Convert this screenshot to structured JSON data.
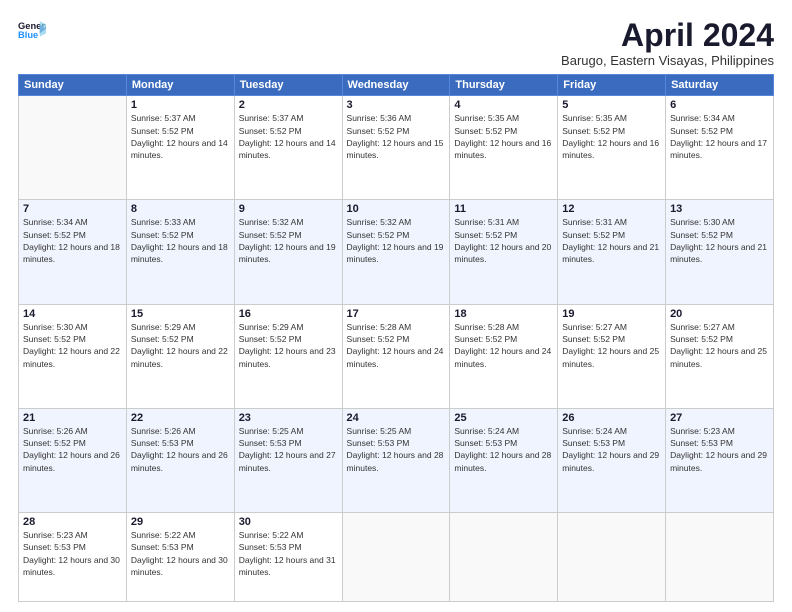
{
  "logo": {
    "line1": "General",
    "line2": "Blue",
    "icon": "▶"
  },
  "title": "April 2024",
  "location": "Barugo, Eastern Visayas, Philippines",
  "days_of_week": [
    "Sunday",
    "Monday",
    "Tuesday",
    "Wednesday",
    "Thursday",
    "Friday",
    "Saturday"
  ],
  "weeks": [
    [
      {
        "day": "",
        "sunrise": "",
        "sunset": "",
        "daylight": ""
      },
      {
        "day": "1",
        "sunrise": "5:37 AM",
        "sunset": "5:52 PM",
        "daylight": "12 hours and 14 minutes."
      },
      {
        "day": "2",
        "sunrise": "5:37 AM",
        "sunset": "5:52 PM",
        "daylight": "12 hours and 14 minutes."
      },
      {
        "day": "3",
        "sunrise": "5:36 AM",
        "sunset": "5:52 PM",
        "daylight": "12 hours and 15 minutes."
      },
      {
        "day": "4",
        "sunrise": "5:35 AM",
        "sunset": "5:52 PM",
        "daylight": "12 hours and 16 minutes."
      },
      {
        "day": "5",
        "sunrise": "5:35 AM",
        "sunset": "5:52 PM",
        "daylight": "12 hours and 16 minutes."
      },
      {
        "day": "6",
        "sunrise": "5:34 AM",
        "sunset": "5:52 PM",
        "daylight": "12 hours and 17 minutes."
      }
    ],
    [
      {
        "day": "7",
        "sunrise": "5:34 AM",
        "sunset": "5:52 PM",
        "daylight": "12 hours and 18 minutes."
      },
      {
        "day": "8",
        "sunrise": "5:33 AM",
        "sunset": "5:52 PM",
        "daylight": "12 hours and 18 minutes."
      },
      {
        "day": "9",
        "sunrise": "5:32 AM",
        "sunset": "5:52 PM",
        "daylight": "12 hours and 19 minutes."
      },
      {
        "day": "10",
        "sunrise": "5:32 AM",
        "sunset": "5:52 PM",
        "daylight": "12 hours and 19 minutes."
      },
      {
        "day": "11",
        "sunrise": "5:31 AM",
        "sunset": "5:52 PM",
        "daylight": "12 hours and 20 minutes."
      },
      {
        "day": "12",
        "sunrise": "5:31 AM",
        "sunset": "5:52 PM",
        "daylight": "12 hours and 21 minutes."
      },
      {
        "day": "13",
        "sunrise": "5:30 AM",
        "sunset": "5:52 PM",
        "daylight": "12 hours and 21 minutes."
      }
    ],
    [
      {
        "day": "14",
        "sunrise": "5:30 AM",
        "sunset": "5:52 PM",
        "daylight": "12 hours and 22 minutes."
      },
      {
        "day": "15",
        "sunrise": "5:29 AM",
        "sunset": "5:52 PM",
        "daylight": "12 hours and 22 minutes."
      },
      {
        "day": "16",
        "sunrise": "5:29 AM",
        "sunset": "5:52 PM",
        "daylight": "12 hours and 23 minutes."
      },
      {
        "day": "17",
        "sunrise": "5:28 AM",
        "sunset": "5:52 PM",
        "daylight": "12 hours and 24 minutes."
      },
      {
        "day": "18",
        "sunrise": "5:28 AM",
        "sunset": "5:52 PM",
        "daylight": "12 hours and 24 minutes."
      },
      {
        "day": "19",
        "sunrise": "5:27 AM",
        "sunset": "5:52 PM",
        "daylight": "12 hours and 25 minutes."
      },
      {
        "day": "20",
        "sunrise": "5:27 AM",
        "sunset": "5:52 PM",
        "daylight": "12 hours and 25 minutes."
      }
    ],
    [
      {
        "day": "21",
        "sunrise": "5:26 AM",
        "sunset": "5:52 PM",
        "daylight": "12 hours and 26 minutes."
      },
      {
        "day": "22",
        "sunrise": "5:26 AM",
        "sunset": "5:53 PM",
        "daylight": "12 hours and 26 minutes."
      },
      {
        "day": "23",
        "sunrise": "5:25 AM",
        "sunset": "5:53 PM",
        "daylight": "12 hours and 27 minutes."
      },
      {
        "day": "24",
        "sunrise": "5:25 AM",
        "sunset": "5:53 PM",
        "daylight": "12 hours and 28 minutes."
      },
      {
        "day": "25",
        "sunrise": "5:24 AM",
        "sunset": "5:53 PM",
        "daylight": "12 hours and 28 minutes."
      },
      {
        "day": "26",
        "sunrise": "5:24 AM",
        "sunset": "5:53 PM",
        "daylight": "12 hours and 29 minutes."
      },
      {
        "day": "27",
        "sunrise": "5:23 AM",
        "sunset": "5:53 PM",
        "daylight": "12 hours and 29 minutes."
      }
    ],
    [
      {
        "day": "28",
        "sunrise": "5:23 AM",
        "sunset": "5:53 PM",
        "daylight": "12 hours and 30 minutes."
      },
      {
        "day": "29",
        "sunrise": "5:22 AM",
        "sunset": "5:53 PM",
        "daylight": "12 hours and 30 minutes."
      },
      {
        "day": "30",
        "sunrise": "5:22 AM",
        "sunset": "5:53 PM",
        "daylight": "12 hours and 31 minutes."
      },
      {
        "day": "",
        "sunrise": "",
        "sunset": "",
        "daylight": ""
      },
      {
        "day": "",
        "sunrise": "",
        "sunset": "",
        "daylight": ""
      },
      {
        "day": "",
        "sunrise": "",
        "sunset": "",
        "daylight": ""
      },
      {
        "day": "",
        "sunrise": "",
        "sunset": "",
        "daylight": ""
      }
    ]
  ]
}
